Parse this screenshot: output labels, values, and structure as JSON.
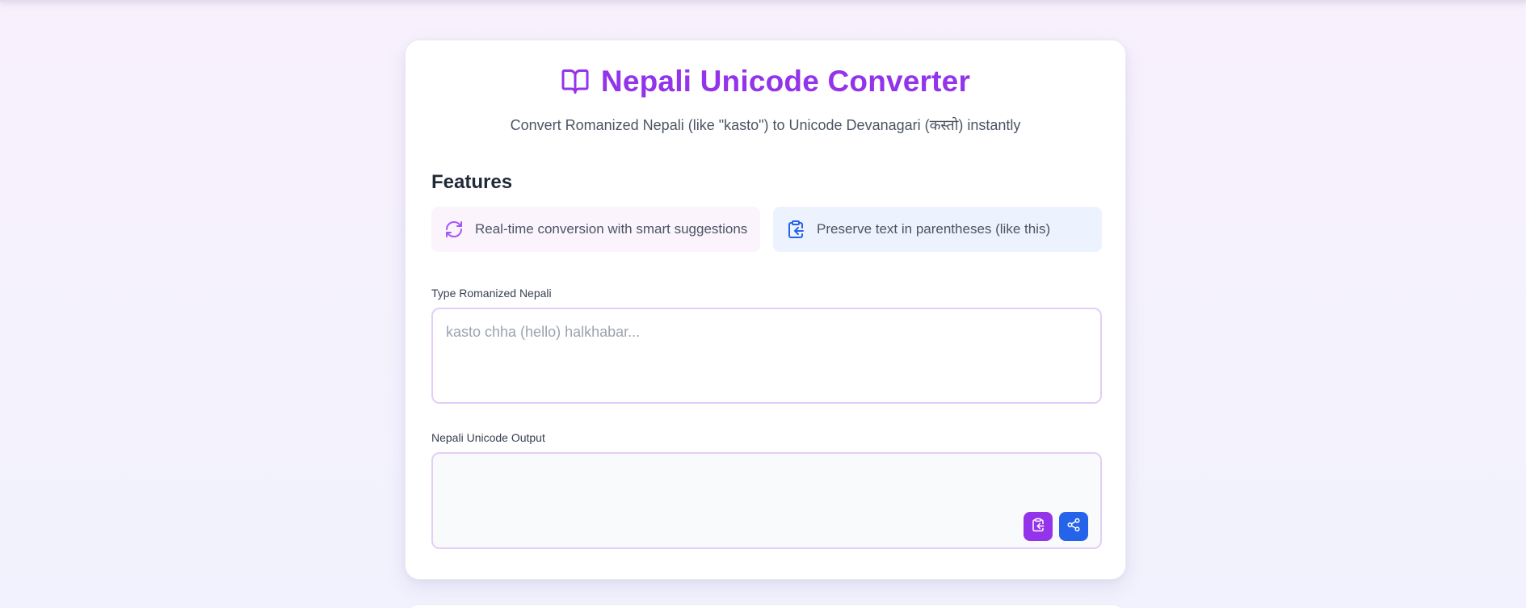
{
  "header": {
    "title": "Nepali Unicode Converter",
    "title_icon": "book-open-icon",
    "subtitle": "Convert Romanized Nepali (like \"kasto\") to Unicode Devanagari (कस्तो) instantly"
  },
  "features": {
    "heading": "Features",
    "items": [
      {
        "icon": "refresh-icon",
        "text": "Real-time conversion with smart suggestions"
      },
      {
        "icon": "clipboard-copy-icon",
        "text": "Preserve text in parentheses (like this)"
      }
    ]
  },
  "input": {
    "label": "Type Romanized Nepali",
    "placeholder": "kasto chha (hello) halkhabar...",
    "value": ""
  },
  "output": {
    "label": "Nepali Unicode Output",
    "value": "",
    "copy_button_icon": "copy-icon",
    "share_button_icon": "share-icon"
  },
  "colors": {
    "accent_purple": "#9333ea",
    "accent_blue": "#2563eb",
    "feature_purple_bg": "#fbf4fd",
    "feature_blue_bg": "#edf3fe",
    "field_border": "#e4cdf8"
  }
}
